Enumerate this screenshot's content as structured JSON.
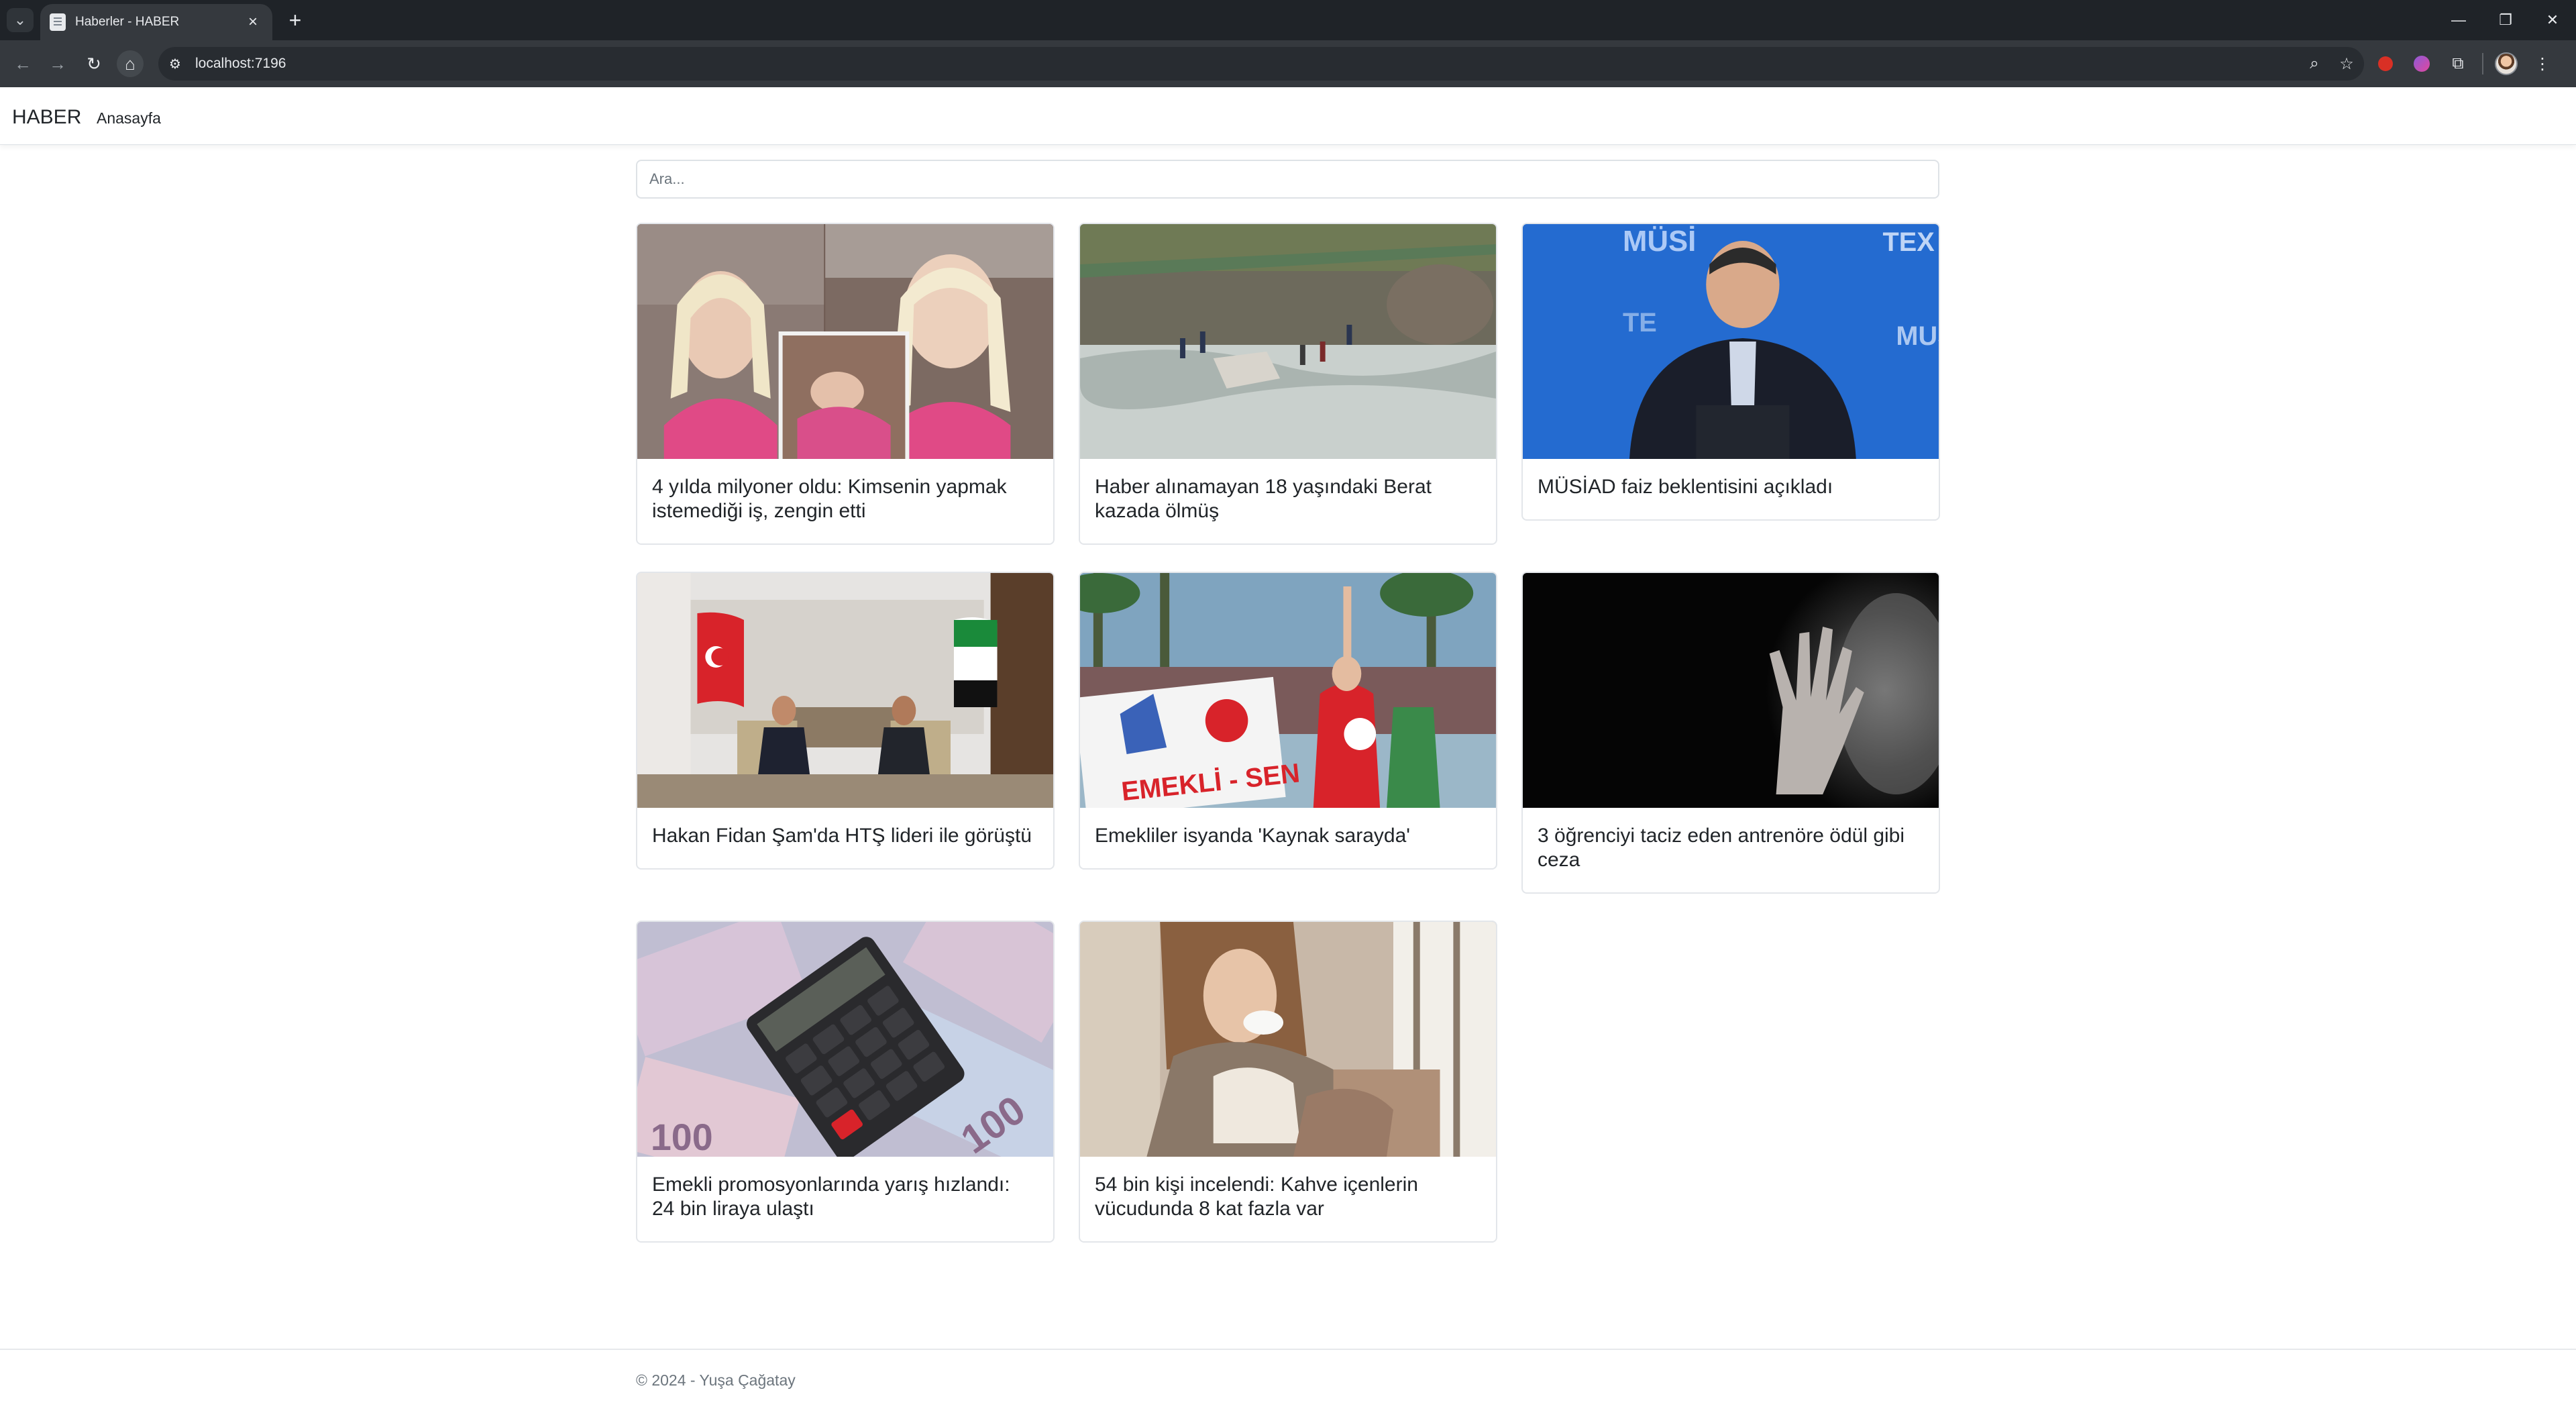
{
  "browser": {
    "tab_title": "Haberler - HABER",
    "url": "localhost:7196"
  },
  "navbar": {
    "brand": "HABER",
    "links": [
      "Anasayfa"
    ]
  },
  "search": {
    "placeholder": "Ara...",
    "value": ""
  },
  "articles": [
    {
      "title": "4 yılda milyoner oldu: Kimsenin yapmak istemediği iş, zengin etti"
    },
    {
      "title": "Haber alınamayan 18 yaşındaki Berat kazada ölmüş"
    },
    {
      "title": "MÜSİAD faiz beklentisini açıkladı"
    },
    {
      "title": "Hakan Fidan Şam'da HTŞ lideri ile görüştü"
    },
    {
      "title": "Emekliler isyanda 'Kaynak sarayda'"
    },
    {
      "title": "3 öğrenciyi taciz eden antrenöre ödül gibi ceza"
    },
    {
      "title": "Emekli promosyonlarında yarış hızlandı: 24 bin liraya ulaştı"
    },
    {
      "title": "54 bin kişi incelendi: Kahve içenlerin vücudunda 8 kat fazla var"
    }
  ],
  "footer": {
    "text": "© 2024 - Yuşa Çağatay"
  }
}
